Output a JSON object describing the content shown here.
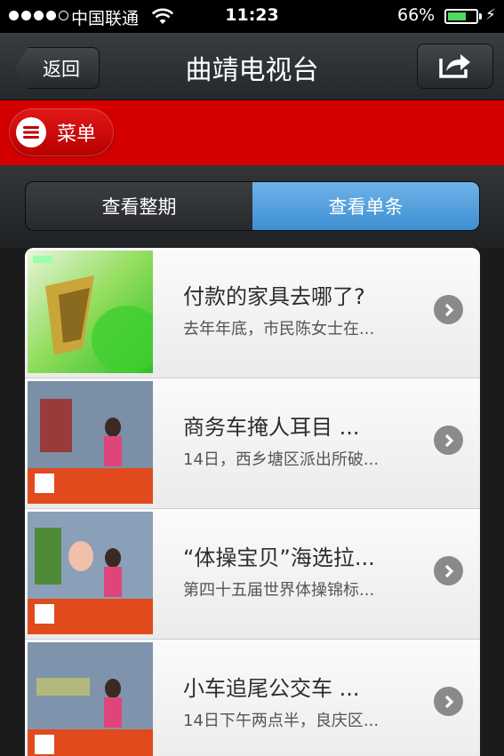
{
  "status_bar": {
    "carrier": "中国联通",
    "time": "11:23",
    "battery_percent": "66%",
    "battery_level": 0.66,
    "icons": [
      "signal-dots-icon",
      "wifi-icon",
      "battery-icon",
      "charging-bolt-icon"
    ]
  },
  "nav": {
    "back_label": "返回",
    "title": "曲靖电视台",
    "share_icon": "share-icon"
  },
  "menu": {
    "label": "菜单",
    "icon": "hamburger-icon"
  },
  "segments": {
    "items": [
      {
        "label": "查看整期",
        "selected": false
      },
      {
        "label": "查看单条",
        "selected": true
      }
    ]
  },
  "list": {
    "items": [
      {
        "title": "付款的家具去哪了?",
        "subtitle": "去年年底，市民陈女士在..."
      },
      {
        "title": "商务车掩人耳目 ...",
        "subtitle": "14日，西乡塘区派出所破..."
      },
      {
        "title": "“体操宝贝”海选拉...",
        "subtitle": "第四十五届世界体操锦标..."
      },
      {
        "title": "小车追尾公交车 ...",
        "subtitle": "14日下午两点半，良庆区..."
      }
    ]
  },
  "colors": {
    "menu_bar": "#d40000",
    "segment_selected": "#4f9fdd",
    "navbar": "#2f3235"
  }
}
